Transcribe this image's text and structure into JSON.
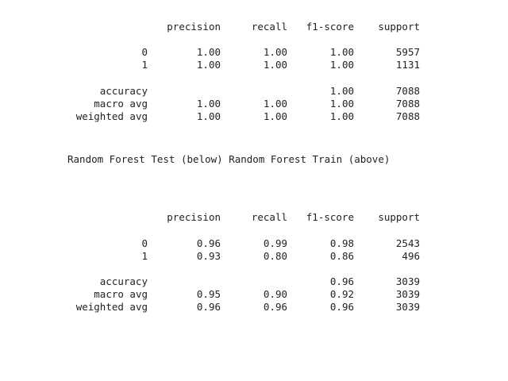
{
  "headers": {
    "precision": "precision",
    "recall": "recall",
    "f1": "f1-score",
    "support": "support"
  },
  "caption": "Random Forest Test (below) Random Forest Train (above)",
  "train_report": {
    "rows": [
      {
        "label": "0",
        "precision": "1.00",
        "recall": "1.00",
        "f1": "1.00",
        "support": "5957"
      },
      {
        "label": "1",
        "precision": "1.00",
        "recall": "1.00",
        "f1": "1.00",
        "support": "1131"
      }
    ],
    "accuracy": {
      "label": "accuracy",
      "f1": "1.00",
      "support": "7088"
    },
    "macro": {
      "label": "macro avg",
      "precision": "1.00",
      "recall": "1.00",
      "f1": "1.00",
      "support": "7088"
    },
    "weighted": {
      "label": "weighted avg",
      "precision": "1.00",
      "recall": "1.00",
      "f1": "1.00",
      "support": "7088"
    }
  },
  "test_report": {
    "rows": [
      {
        "label": "0",
        "precision": "0.96",
        "recall": "0.99",
        "f1": "0.98",
        "support": "2543"
      },
      {
        "label": "1",
        "precision": "0.93",
        "recall": "0.80",
        "f1": "0.86",
        "support": "496"
      }
    ],
    "accuracy": {
      "label": "accuracy",
      "f1": "0.96",
      "support": "3039"
    },
    "macro": {
      "label": "macro avg",
      "precision": "0.95",
      "recall": "0.90",
      "f1": "0.92",
      "support": "3039"
    },
    "weighted": {
      "label": "weighted avg",
      "precision": "0.96",
      "recall": "0.96",
      "f1": "0.96",
      "support": "3039"
    }
  }
}
